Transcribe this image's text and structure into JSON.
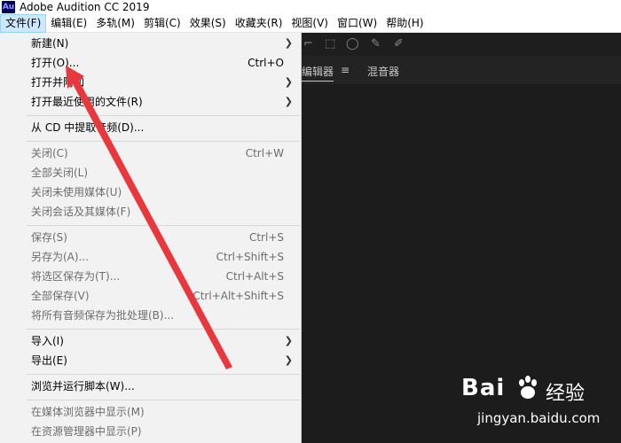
{
  "window": {
    "app_icon": "Au",
    "title": "Adobe Audition CC 2019"
  },
  "menubar": [
    "文件(F)",
    "编辑(E)",
    "多轨(M)",
    "剪辑(C)",
    "效果(S)",
    "收藏夹(R)",
    "视图(V)",
    "窗口(W)",
    "帮助(H)"
  ],
  "active_menu": "文件(F)",
  "editor_tabs": {
    "tab1": "编辑器",
    "tab2": "混音器"
  },
  "file_menu": [
    {
      "label": "新建(N)",
      "shortcut": "",
      "submenu": true,
      "enabled": true
    },
    {
      "label": "打开(O)...",
      "shortcut": "Ctrl+O",
      "submenu": false,
      "enabled": true
    },
    {
      "label": "打开并附加",
      "shortcut": "",
      "submenu": true,
      "enabled": true
    },
    {
      "label": "打开最近使用的文件(R)",
      "shortcut": "",
      "submenu": true,
      "enabled": true
    },
    {
      "label": "从 CD 中提取音频(D)...",
      "shortcut": "",
      "submenu": false,
      "enabled": true
    },
    {
      "label": "关闭(C)",
      "shortcut": "Ctrl+W",
      "submenu": false,
      "enabled": false
    },
    {
      "label": "全部关闭(L)",
      "shortcut": "",
      "submenu": false,
      "enabled": false
    },
    {
      "label": "关闭未使用媒体(U)",
      "shortcut": "",
      "submenu": false,
      "enabled": false
    },
    {
      "label": "关闭会话及其媒体(F)",
      "shortcut": "",
      "submenu": false,
      "enabled": false
    },
    {
      "label": "保存(S)",
      "shortcut": "Ctrl+S",
      "submenu": false,
      "enabled": false
    },
    {
      "label": "另存为(A)...",
      "shortcut": "Ctrl+Shift+S",
      "submenu": false,
      "enabled": false
    },
    {
      "label": "将选区保存为(T)...",
      "shortcut": "Ctrl+Alt+S",
      "submenu": false,
      "enabled": false
    },
    {
      "label": "全部保存(V)",
      "shortcut": "Ctrl+Alt+Shift+S",
      "submenu": false,
      "enabled": false
    },
    {
      "label": "将所有音频保存为批处理(B)...",
      "shortcut": "",
      "submenu": false,
      "enabled": false
    },
    {
      "label": "导入(I)",
      "shortcut": "",
      "submenu": true,
      "enabled": true
    },
    {
      "label": "导出(E)",
      "shortcut": "",
      "submenu": true,
      "enabled": true
    },
    {
      "label": "浏览并运行脚本(W)...",
      "shortcut": "",
      "submenu": false,
      "enabled": true
    },
    {
      "label": "在媒体浏览器中显示(M)",
      "shortcut": "",
      "submenu": false,
      "enabled": false
    },
    {
      "label": "在资源管理器中显示(P)",
      "shortcut": "",
      "submenu": false,
      "enabled": false
    }
  ],
  "annotation": {
    "type": "red-arrow",
    "points_to": "打开(O)...",
    "color": "#e8383d"
  },
  "watermark": {
    "logo": "Bai",
    "logo_suffix": "经验",
    "url": "jingyan.baidu.com"
  },
  "icons": {
    "submenu": "chevron-right-icon",
    "paw": "baidu-paw-icon"
  }
}
